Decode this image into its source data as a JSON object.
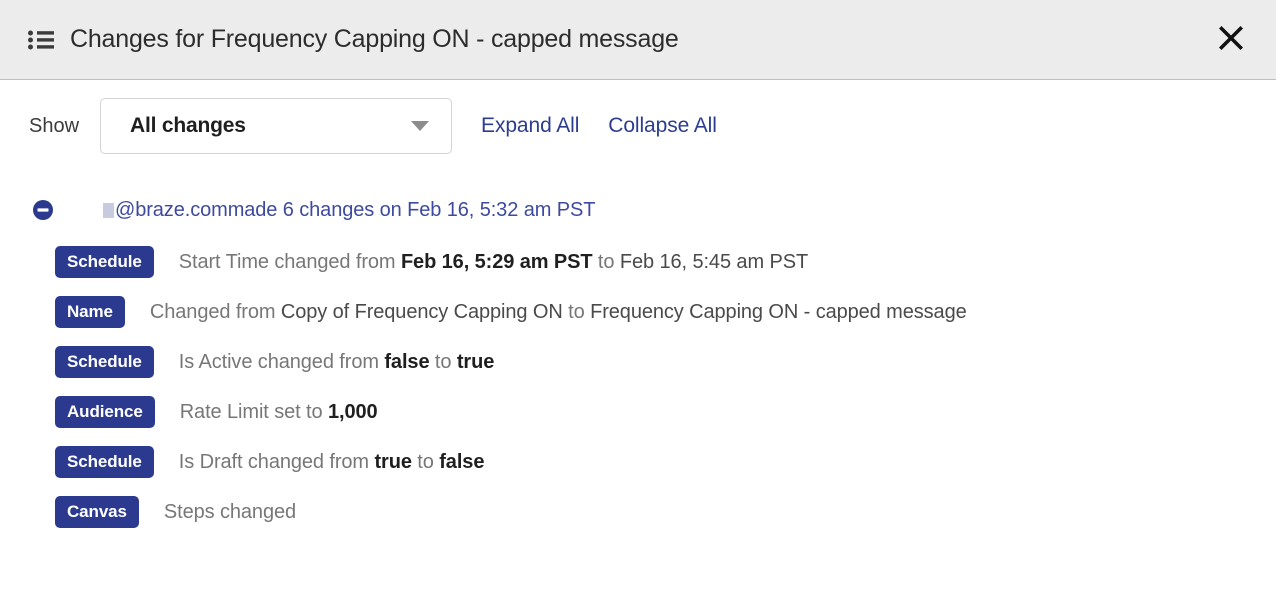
{
  "header": {
    "icon": "list-icon",
    "title": "Changes for Frequency Capping ON - capped message",
    "close_icon": "close-icon"
  },
  "toolbar": {
    "show_label": "Show",
    "filter_value": "All changes",
    "filter_options": [
      "All changes"
    ],
    "expand_all_label": "Expand All",
    "collapse_all_label": "Collapse All",
    "caret_icon": "chevron-down-icon"
  },
  "group": {
    "toggle_icon": "minus-circle-icon",
    "toggle_state": "expanded",
    "author": "@braze.com",
    "summary_suffix": " made 6 changes on Feb 16, 5:32 am PST",
    "changes": [
      {
        "badge": "Schedule",
        "parts": [
          {
            "text": "Start Time changed from ",
            "style": "muted"
          },
          {
            "text": "Feb 16, 5:29 am PST",
            "style": "value"
          },
          {
            "text": " to ",
            "style": "muted"
          },
          {
            "text": "Feb 16, 5:45 am PST",
            "style": "value-light"
          }
        ]
      },
      {
        "badge": "Name",
        "parts": [
          {
            "text": "Changed from ",
            "style": "muted"
          },
          {
            "text": "Copy of Frequency Capping ON",
            "style": "value-light"
          },
          {
            "text": " to ",
            "style": "muted"
          },
          {
            "text": "Frequency Capping ON - capped message",
            "style": "value-light"
          }
        ]
      },
      {
        "badge": "Schedule",
        "parts": [
          {
            "text": "Is Active changed from ",
            "style": "muted"
          },
          {
            "text": "false",
            "style": "value"
          },
          {
            "text": " to ",
            "style": "muted"
          },
          {
            "text": "true",
            "style": "value"
          }
        ]
      },
      {
        "badge": "Audience",
        "parts": [
          {
            "text": "Rate Limit set to ",
            "style": "muted"
          },
          {
            "text": "1,000",
            "style": "value"
          }
        ]
      },
      {
        "badge": "Schedule",
        "parts": [
          {
            "text": "Is Draft changed from ",
            "style": "muted"
          },
          {
            "text": "true",
            "style": "value"
          },
          {
            "text": " to ",
            "style": "muted"
          },
          {
            "text": "false",
            "style": "value"
          }
        ]
      },
      {
        "badge": "Canvas",
        "parts": [
          {
            "text": "Steps changed",
            "style": "muted"
          }
        ]
      }
    ]
  },
  "colors": {
    "badge_bg": "#2b3a8f",
    "link": "#2c3d91",
    "group_title": "#3d4aa0",
    "header_bg": "#ececec"
  }
}
